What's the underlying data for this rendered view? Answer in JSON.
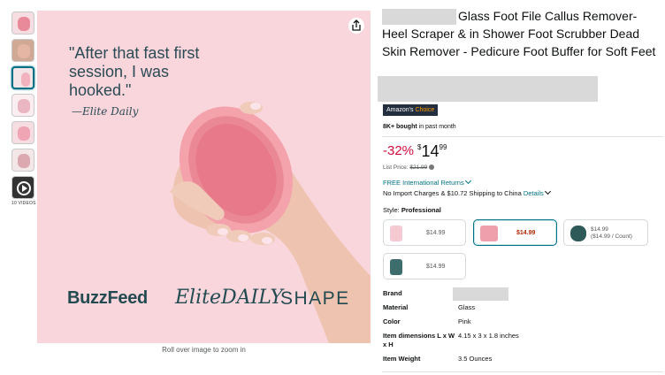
{
  "gallery": {
    "thumbnails": [
      "thumbnail-1",
      "thumbnail-2",
      "thumbnail-3",
      "thumbnail-4",
      "thumbnail-5",
      "thumbnail-6"
    ],
    "video_label": "10 VIDEOS",
    "zoom_hint": "Roll over image to zoom in"
  },
  "main_image": {
    "quote": "\"After that fast first session, I was hooked.\"",
    "signature": "—Elite Daily",
    "brand_logos": [
      "BuzzFeed",
      "EliteDAILY",
      "SHAPE"
    ]
  },
  "product": {
    "title": "Glass Foot File Callus Remover-Heel Scraper & in Shower Foot Scrubber Dead Skin Remover - Pedicure Foot Buffer for Soft Feet",
    "badge_prefix": "Amazon's",
    "badge_accent": "Choice",
    "bought_bold": "8K+ bought",
    "bought_rest": " in past month"
  },
  "pricing": {
    "discount": "-32%",
    "currency": "$",
    "whole": "14",
    "fraction": "99",
    "list_price_label": "List Price: ",
    "list_price": "$21.99"
  },
  "delivery": {
    "returns": "FREE International Returns",
    "shipping_text": "No Import Charges & $10.72 Shipping to China ",
    "details_link": "Details"
  },
  "style": {
    "label": "Style: ",
    "selected": "Professional",
    "options": [
      {
        "price": "$14.99"
      },
      {
        "price": "$14.99"
      },
      {
        "price": "$14.99",
        "unit_price": "($14.99 / Count)"
      },
      {
        "price": "$14.99"
      }
    ]
  },
  "specs": [
    {
      "key": "Brand",
      "value": ""
    },
    {
      "key": "Material",
      "value": "Glass"
    },
    {
      "key": "Color",
      "value": "Pink"
    },
    {
      "key": "Item dimensions L x W x H",
      "value": "4.15 x 3 x 1.8 inches"
    },
    {
      "key": "Item Weight",
      "value": "3.5 Ounces"
    }
  ],
  "colors": {
    "accent_teal": "#007185",
    "discount_red": "#cc0c39",
    "badge_bg": "#232f3e",
    "badge_orange": "#ff9900",
    "image_bg": "#f9d5dc"
  }
}
